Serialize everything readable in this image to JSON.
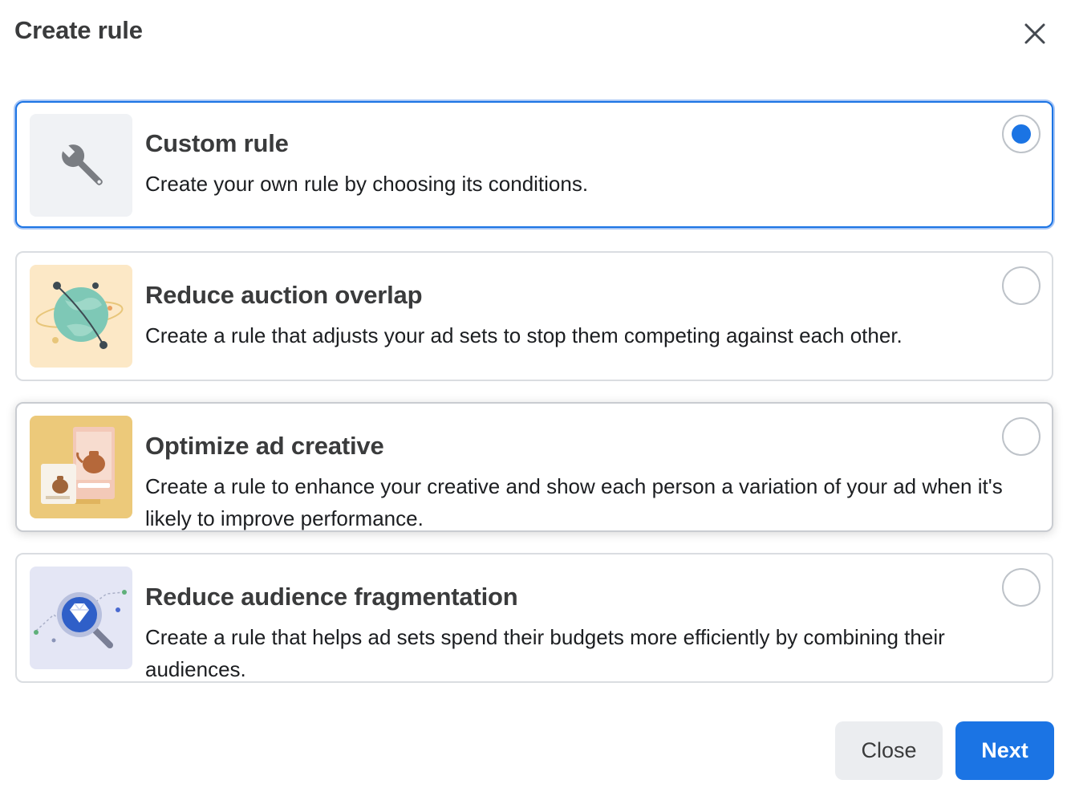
{
  "dialog": {
    "title": "Create rule",
    "close_icon": "close-icon"
  },
  "options": [
    {
      "title": "Custom rule",
      "description": "Create your own rule by choosing its conditions.",
      "selected": true,
      "icon": "wrench-icon"
    },
    {
      "title": "Reduce auction overlap",
      "description": "Create a rule that adjusts your ad sets to stop them competing against each other.",
      "selected": false,
      "icon": "globe-illustration"
    },
    {
      "title": "Optimize ad creative",
      "description": "Create a rule to enhance your creative and show each person a variation of your ad when it's likely to improve performance.",
      "selected": false,
      "icon": "teapot-ad-illustration"
    },
    {
      "title": "Reduce audience fragmentation",
      "description": "Create a rule that helps ad sets spend their budgets more efficiently by combining their audiences.",
      "selected": false,
      "icon": "diamond-magnifier-illustration"
    }
  ],
  "footer": {
    "close_label": "Close",
    "next_label": "Next"
  },
  "colors": {
    "accent": "#1b74e4",
    "border": "#dadde1",
    "secondary_button": "#ebedf0"
  }
}
